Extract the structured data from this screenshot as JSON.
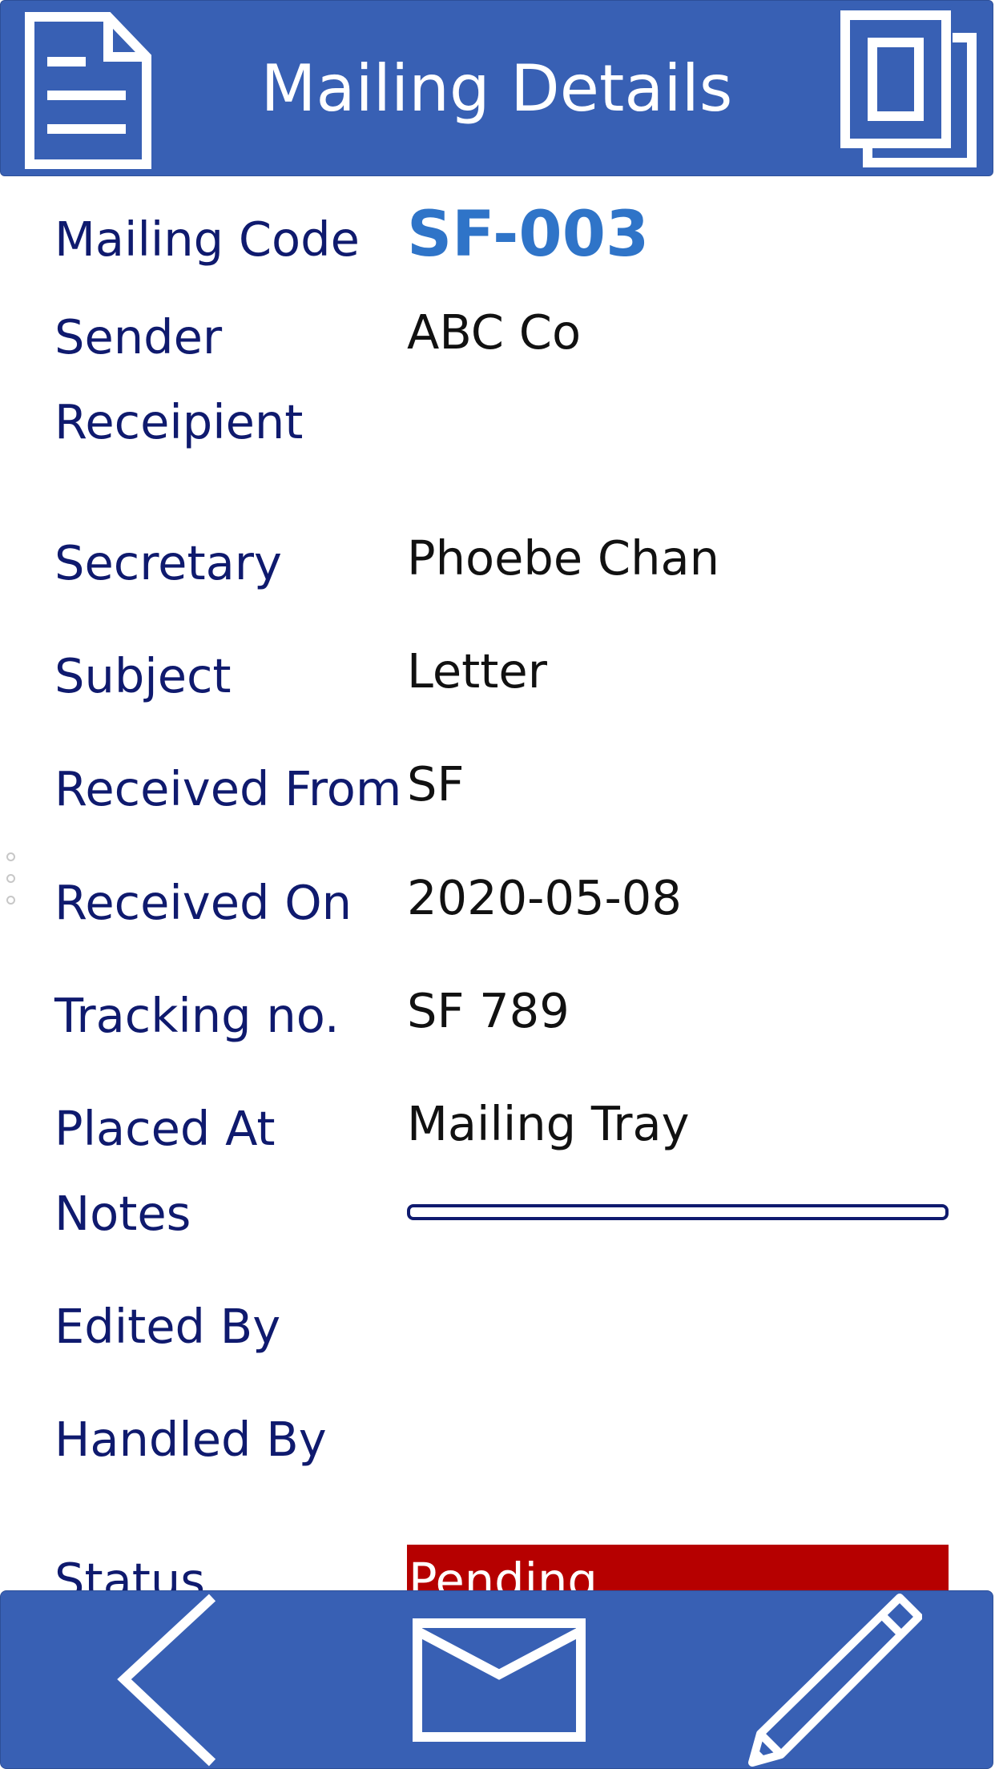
{
  "header": {
    "title": "Mailing Details",
    "left_icon": "document-icon",
    "right_icon": "copy-icon"
  },
  "fields": {
    "mailing_code": {
      "label": "Mailing Code",
      "value": "SF-003"
    },
    "sender": {
      "label": "Sender",
      "value": "ABC Co"
    },
    "recipient": {
      "label": "Receipient",
      "value": ""
    },
    "secretary": {
      "label": "Secretary",
      "value": "Phoebe Chan"
    },
    "subject": {
      "label": "Subject",
      "value": "Letter"
    },
    "received_from": {
      "label": "Received From",
      "value": "SF"
    },
    "received_on": {
      "label": "Received On",
      "value": "2020-05-08"
    },
    "tracking_no": {
      "label": "Tracking no.",
      "value": "SF 789"
    },
    "placed_at": {
      "label": "Placed At",
      "value": "Mailing Tray"
    },
    "notes": {
      "label": "Notes",
      "value": ""
    },
    "edited_by": {
      "label": "Edited By",
      "value": ""
    },
    "handled_by": {
      "label": "Handled By",
      "value": ""
    },
    "status": {
      "label": "Status",
      "value": "Pending"
    }
  },
  "footer": {
    "back_icon": "chevron-left-icon",
    "mail_icon": "envelope-icon",
    "edit_icon": "pencil-icon"
  },
  "colors": {
    "bar_blue": "#3860b4",
    "label_navy": "#0f1a6e",
    "code_blue": "#2f74c8",
    "status_red": "#b60000"
  }
}
